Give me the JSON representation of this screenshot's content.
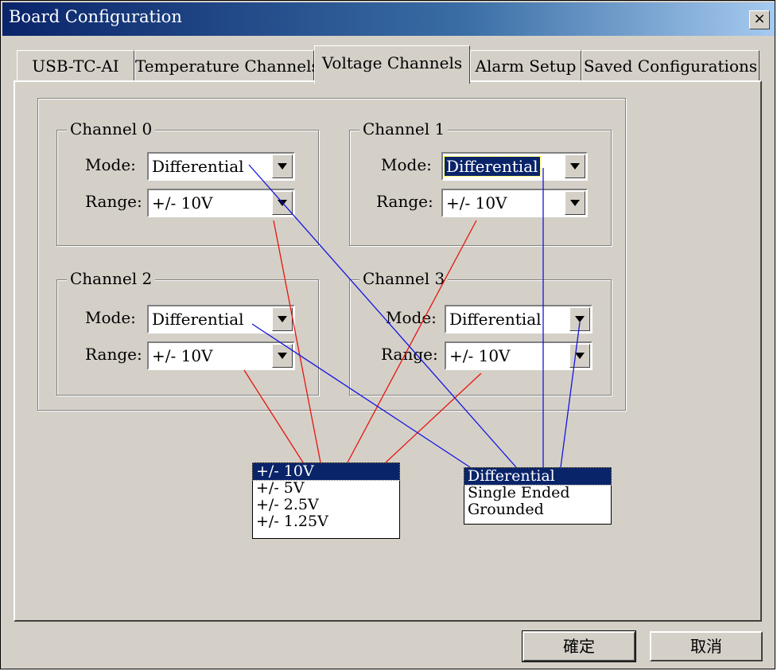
{
  "window": {
    "title": "Board Configuration",
    "close_label": "×"
  },
  "tabs": [
    {
      "label": "USB-TC-AI"
    },
    {
      "label": "Temperature Channels"
    },
    {
      "label": "Voltage Channels"
    },
    {
      "label": "Alarm Setup"
    },
    {
      "label": "Saved Configurations"
    }
  ],
  "active_tab": "Voltage Channels",
  "field_labels": {
    "mode": "Mode:",
    "range": "Range:"
  },
  "channels": [
    {
      "title": "Channel 0",
      "mode": "Differential",
      "range": "+/- 10V"
    },
    {
      "title": "Channel 1",
      "mode": "Differential",
      "range": "+/- 10V"
    },
    {
      "title": "Channel 2",
      "mode": "Differential",
      "range": "+/- 10V"
    },
    {
      "title": "Channel 3",
      "mode": "Differential",
      "range": "+/- 10V"
    }
  ],
  "range_options": [
    "+/- 10V",
    "+/- 5V",
    "+/- 2.5V",
    "+/- 1.25V"
  ],
  "mode_options": [
    "Differential",
    "Single Ended",
    "Grounded"
  ],
  "buttons": {
    "ok": "確定",
    "cancel": "取消"
  },
  "colors": {
    "range_connector": "#e8140c",
    "mode_connector": "#1414e0",
    "selection": "#0a246a"
  }
}
